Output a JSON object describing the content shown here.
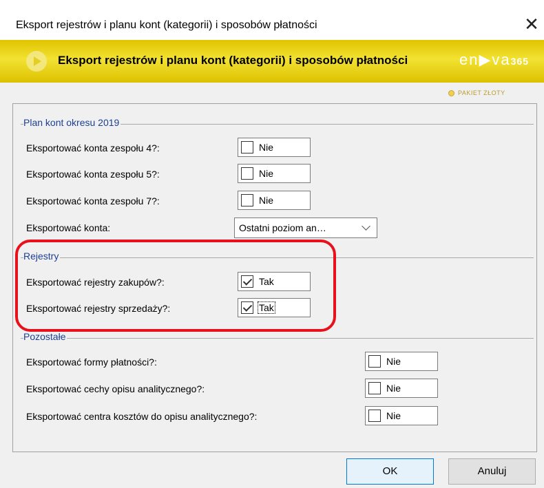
{
  "window": {
    "title": "Eksport rejestrów i planu kont (kategorii) i sposobów płatności",
    "close_glyph": "✕"
  },
  "banner": {
    "title": "Eksport rejestrów i planu kont (kategorii) i sposobów płatności",
    "logo_text": "en▶va",
    "logo_num": "365",
    "package": "PAKIET ZŁOTY"
  },
  "sections": {
    "plan": {
      "title": "Plan kont okresu 2019",
      "rows": [
        {
          "label": "Eksportować konta zespołu 4?:",
          "value": "Nie",
          "checked": false
        },
        {
          "label": "Eksportować konta zespołu 5?:",
          "value": "Nie",
          "checked": false
        },
        {
          "label": "Eksportować konta zespołu 7?:",
          "value": "Nie",
          "checked": false
        }
      ],
      "konta": {
        "label": "Eksportować konta:",
        "value": "Ostatni poziom an…"
      }
    },
    "rejestry": {
      "title": "Rejestry",
      "rows": [
        {
          "label": "Eksportować rejestry zakupów?:",
          "value": "Tak",
          "checked": true
        },
        {
          "label": "Eksportować rejestry sprzedaży?:",
          "value": "Tak",
          "checked": true
        }
      ]
    },
    "pozostale": {
      "title": "Pozostałe",
      "rows": [
        {
          "label": "Eksportować formy płatności?:",
          "value": "Nie",
          "checked": false
        },
        {
          "label": "Eksportować cechy opisu analitycznego?:",
          "value": "Nie",
          "checked": false
        },
        {
          "label": "Eksportować centra kosztów do opisu analitycznego?:",
          "value": "Nie",
          "checked": false
        }
      ]
    }
  },
  "buttons": {
    "ok": "OK",
    "cancel": "Anuluj"
  },
  "colors": {
    "banner": "#f2e233",
    "section_title": "#1c3f94",
    "highlight": "#e8101a"
  }
}
